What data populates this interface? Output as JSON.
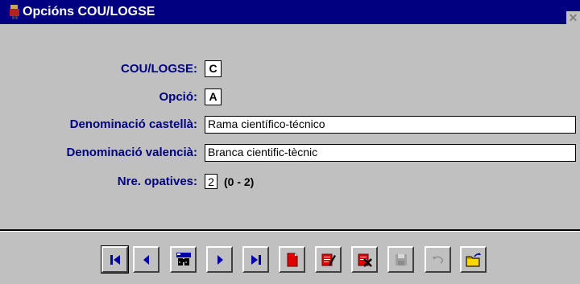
{
  "window": {
    "title": "Opcións COU/LOGSE",
    "close_glyph": "✕"
  },
  "form": {
    "cou_logse": {
      "label": "COU/LOGSE:",
      "value": "C"
    },
    "opcio": {
      "label": "Opció:",
      "value": "A"
    },
    "denominacio_castella": {
      "label": "Denominació castellà:",
      "value": "Rama científico-técnico"
    },
    "denominacio_valencia": {
      "label": "Denominació valencià:",
      "value": "Branca cientific-tècnic"
    },
    "nre_opatives": {
      "label": "Nre. opatives:",
      "value": "2",
      "range": "(0 - 2)"
    }
  },
  "toolbar": {
    "buttons": [
      {
        "icon": "first-record-icon"
      },
      {
        "icon": "previous-record-icon"
      },
      {
        "icon": "find-binoculars-icon"
      },
      {
        "icon": "next-record-icon"
      },
      {
        "icon": "last-record-icon"
      },
      {
        "icon": "new-record-icon"
      },
      {
        "icon": "edit-record-icon"
      },
      {
        "icon": "delete-record-icon"
      },
      {
        "icon": "save-disk-icon",
        "disabled": true
      },
      {
        "icon": "undo-icon",
        "disabled": true
      },
      {
        "icon": "exit-folder-icon"
      }
    ]
  },
  "colors": {
    "titlebar": "#000080",
    "label": "#000080",
    "face": "#c0c0c0",
    "accent_icon": "#0000aa",
    "red_icon": "#e00000"
  }
}
